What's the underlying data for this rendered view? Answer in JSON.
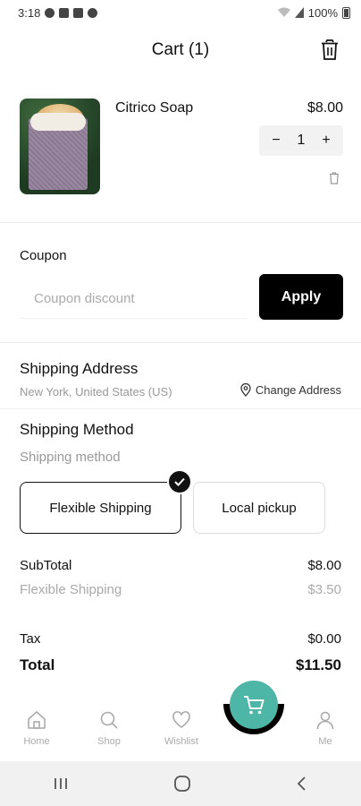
{
  "status_bar": {
    "time": "3:18",
    "battery": "100%"
  },
  "header": {
    "title": "Cart (1)"
  },
  "cart_item": {
    "name": "Citrico Soap",
    "price": "$8.00",
    "quantity": "1",
    "minus": "−",
    "plus": "+"
  },
  "coupon": {
    "label": "Coupon",
    "placeholder": "Coupon discount",
    "value": "",
    "apply_label": "Apply"
  },
  "shipping_address": {
    "title": "Shipping Address",
    "address": "New York, United States (US)",
    "change_label": "Change Address"
  },
  "shipping_method": {
    "title": "Shipping Method",
    "subtitle": "Shipping method",
    "options": [
      {
        "label": "Flexible Shipping",
        "selected": true
      },
      {
        "label": "Local pickup",
        "selected": false
      }
    ]
  },
  "totals": {
    "subtotal_label": "SubTotal",
    "subtotal_value": "$8.00",
    "shipping_label": "Flexible Shipping",
    "shipping_value": "$3.50",
    "tax_label": "Tax",
    "tax_value": "$0.00",
    "total_label": "Total",
    "total_value": "$11.50"
  },
  "bottom_nav": {
    "items": [
      {
        "label": "Home",
        "icon": "home-icon"
      },
      {
        "label": "Shop",
        "icon": "search-icon"
      },
      {
        "label": "Wishlist",
        "icon": "heart-icon"
      },
      {
        "label": "Me",
        "icon": "person-icon"
      }
    ],
    "fab_icon": "cart-icon"
  },
  "colors": {
    "accent": "#4db6a6",
    "primary_button": "#000000",
    "muted_text": "#aaaaaa"
  }
}
